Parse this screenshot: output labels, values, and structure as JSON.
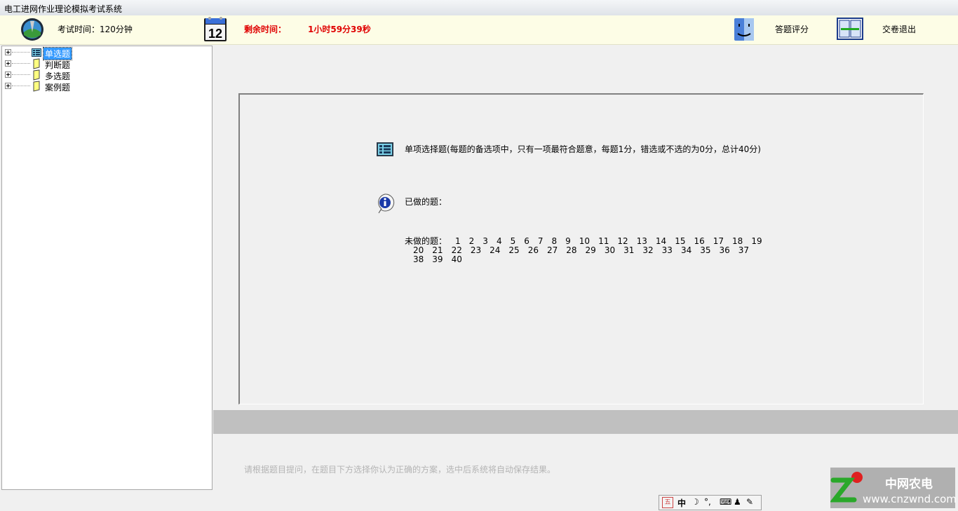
{
  "window": {
    "title": "电工进网作业理论模拟考试系统"
  },
  "toolbar": {
    "exam_time": "考试时间：120分钟",
    "calendar_number": "12",
    "remaining_label": "剩余时间：",
    "remaining_value": "1小时59分39秒",
    "score_label": "答题评分",
    "submit_label": "交卷退出"
  },
  "tree": {
    "items": [
      {
        "label": "单选题",
        "icon": "list-icon",
        "selected": true
      },
      {
        "label": "判断题",
        "icon": "book-icon"
      },
      {
        "label": "多选题",
        "icon": "book-icon"
      },
      {
        "label": "案例题",
        "icon": "book-icon"
      }
    ]
  },
  "content": {
    "description": "单项选择题(每题的备选项中，只有一项最符合题意，每题1分，错选或不选的为0分，总计40分)",
    "done_label": "已做的题：",
    "undone_label": "未做的题：",
    "undone_numbers": [
      "1",
      "2",
      "3",
      "4",
      "5",
      "6",
      "7",
      "8",
      "9",
      "10",
      "11",
      "12",
      "13",
      "14",
      "15",
      "16",
      "17",
      "18",
      "19",
      "20",
      "21",
      "22",
      "23",
      "24",
      "25",
      "26",
      "27",
      "28",
      "29",
      "30",
      "31",
      "32",
      "33",
      "34",
      "35",
      "36",
      "37",
      "38",
      "39",
      "40"
    ]
  },
  "hint": "请根据题目提问，在题目下方选择你认为正确的方案，选中后系统将自动保存结果。",
  "ime": {
    "mode_char": "中"
  },
  "watermark": {
    "cn": "中网农电",
    "en": "www.cnzwnd.com"
  },
  "colors": {
    "accent_red": "#e00000",
    "selection_blue": "#3399ff",
    "toolbar_bg": "#fdfde6"
  }
}
